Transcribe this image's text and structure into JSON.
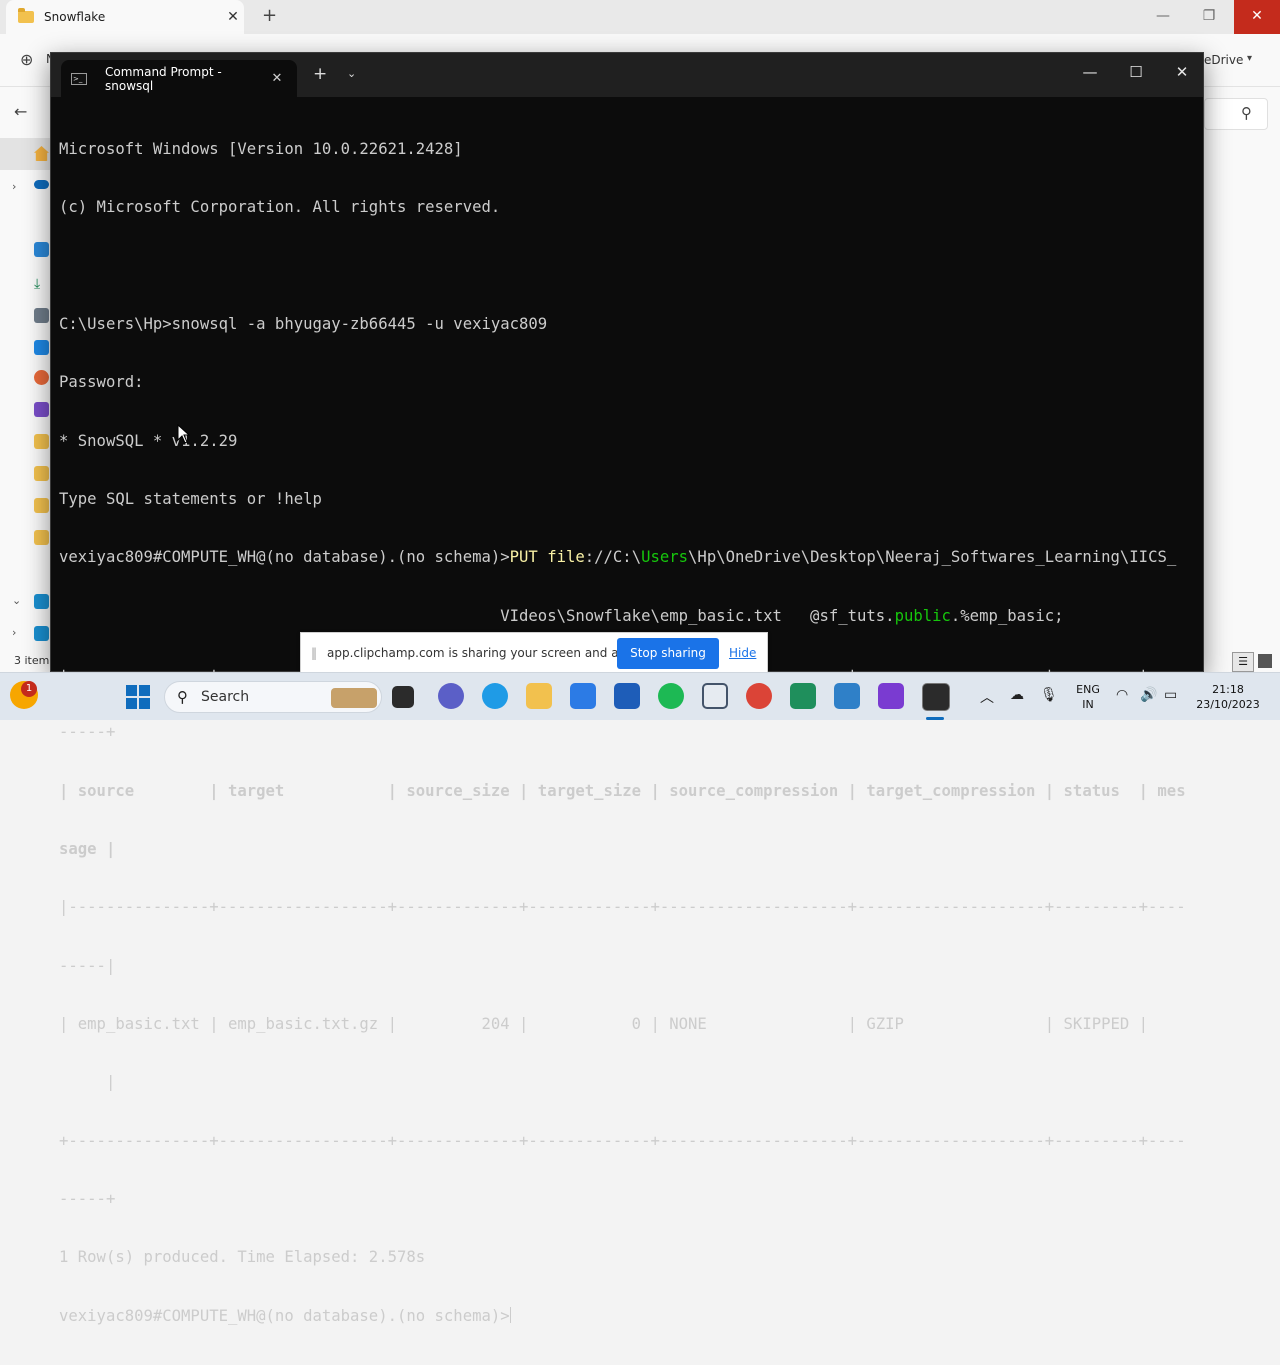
{
  "explorer": {
    "tab_title": "Snowflake",
    "tab_close": "✕",
    "new_tab": "+",
    "window_controls": {
      "minimize": "—",
      "maximize": "❐",
      "close": "✕"
    },
    "new_button_letter": "N",
    "onedrive_label": "eDrive",
    "items_count": "3 item"
  },
  "terminal": {
    "tab_title": "Command Prompt - snowsql",
    "tab_close": "✕",
    "new_tab": "+",
    "dropdown": "⌄",
    "window_controls": {
      "minimize": "—",
      "maximize": "☐",
      "close": "✕"
    },
    "lines": {
      "l1": "Microsoft Windows [Version 10.0.22621.2428]",
      "l2": "(c) Microsoft Corporation. All rights reserved.",
      "l4": "C:\\Users\\Hp>snowsql -a bhyugay-zb66445 -u vexiyac809",
      "l5": "Password:",
      "l6": "* SnowSQL * v1.2.29",
      "l7": "Type SQL statements or !help",
      "l8_prompt": "vexiyac809#COMPUTE_WH@(no database).(no schema)>",
      "l8_put": "PUT file",
      "l8_a": "://C:\\",
      "l8_users": "Users",
      "l8_b": "\\Hp\\OneDrive\\Desktop\\Neeraj_Softwares_Learning\\IICS_",
      "l9_indent": "                                               ",
      "l9_a": "VIdeos\\Snowflake\\emp_basic.txt   @sf_tuts.",
      "l9_public": "public",
      "l9_b": ".%emp_basic;",
      "l10": "+---------------+------------------+-------------+-------------+--------------------+--------------------+---------+----",
      "l11": "-----+",
      "l12": "| source        | target           | source_size | target_size | source_compression | target_compression | status  | mes",
      "l13": "sage |",
      "l14": "|---------------+------------------+-------------+-------------+--------------------+--------------------+---------+----",
      "l15": "-----|",
      "l16": "| emp_basic.txt | emp_basic.txt.gz |         204 |           0 | NONE               | GZIP               | SKIPPED |",
      "l17": "     |",
      "l18": "+---------------+------------------+-------------+-------------+--------------------+--------------------+---------+----",
      "l19": "-----+",
      "l20": "1 Row(s) produced. Time Elapsed: 2.578s",
      "l21": "vexiyac809#COMPUTE_WH@(no database).(no schema)>"
    }
  },
  "share_bar": {
    "grip": "||",
    "message": "app.clipchamp.com is sharing your screen and audio.",
    "stop_label": "Stop sharing",
    "hide_label": "Hide"
  },
  "taskbar": {
    "weather_badge": "1",
    "search_icon": "⚲",
    "search_placeholder": "Search",
    "tray": {
      "show_hidden": "︿",
      "lang_line1": "ENG",
      "lang_line2": "IN",
      "time": "21:18",
      "date": "23/10/2023"
    }
  },
  "colors": {
    "terminal_bg": "#0c0c0c",
    "terminal_text": "#cccccc",
    "terminal_yellow": "#f9f1a5",
    "terminal_green": "#16c60c",
    "accent_blue": "#1a73e8",
    "close_red": "#c42b1c"
  },
  "icons": {
    "explorer_tab": "folder-icon",
    "terminal_tab": "cmd-icon",
    "start": "windows-start-icon",
    "search": "search-icon"
  }
}
